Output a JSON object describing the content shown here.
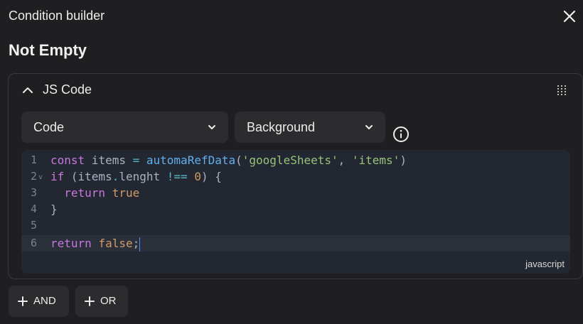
{
  "dialog": {
    "title": "Condition builder",
    "condition_title": "Not Empty"
  },
  "panel": {
    "title": "JS Code",
    "type_select": {
      "value": "Code"
    },
    "context_select": {
      "value": "Background"
    }
  },
  "editor": {
    "language": "javascript",
    "lines": [
      {
        "number": "1",
        "text": "const items = automaRefData('googleSheets', 'items')"
      },
      {
        "number": "2",
        "text": "if (items.lenght !== 0) {"
      },
      {
        "number": "3",
        "text": "  return true"
      },
      {
        "number": "4",
        "text": "}"
      },
      {
        "number": "5",
        "text": ""
      },
      {
        "number": "6",
        "text": "return false;"
      }
    ]
  },
  "actions": {
    "and_label": "AND",
    "or_label": "OR"
  },
  "colors": {
    "background": "#1f1f21",
    "panel_border": "#3a3a3d",
    "control_bg": "#2c2c2f",
    "editor_bg": "#232731",
    "keyword": "#c678dd",
    "function": "#61afef",
    "string": "#98c379",
    "number": "#d19a66",
    "cursor": "#528bff"
  }
}
